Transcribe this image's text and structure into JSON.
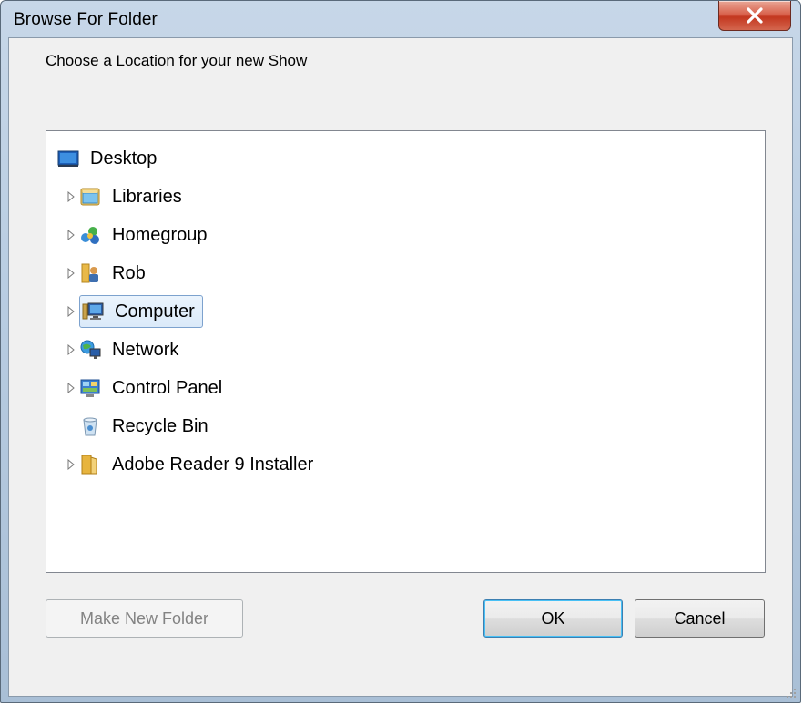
{
  "window": {
    "title": "Browse For Folder"
  },
  "dialog": {
    "prompt": "Choose a Location for your new Show"
  },
  "tree": {
    "items": [
      {
        "label": "Desktop",
        "icon": "desktop-icon",
        "expandable": false,
        "selected": false
      },
      {
        "label": "Libraries",
        "icon": "libraries-icon",
        "expandable": true,
        "selected": false
      },
      {
        "label": "Homegroup",
        "icon": "homegroup-icon",
        "expandable": true,
        "selected": false
      },
      {
        "label": "Rob",
        "icon": "user-folder-icon",
        "expandable": true,
        "selected": false
      },
      {
        "label": "Computer",
        "icon": "computer-icon",
        "expandable": true,
        "selected": true
      },
      {
        "label": "Network",
        "icon": "network-icon",
        "expandable": true,
        "selected": false
      },
      {
        "label": "Control Panel",
        "icon": "control-panel-icon",
        "expandable": true,
        "selected": false
      },
      {
        "label": "Recycle Bin",
        "icon": "recycle-bin-icon",
        "expandable": false,
        "selected": false
      },
      {
        "label": "Adobe Reader 9 Installer",
        "icon": "folder-icon",
        "expandable": true,
        "selected": false
      }
    ]
  },
  "buttons": {
    "make_new_folder": "Make New Folder",
    "ok": "OK",
    "cancel": "Cancel"
  },
  "colors": {
    "titlebar": "#b9cde2",
    "close_button": "#c3371f",
    "selection": "#dbeaf9",
    "dialog_bg": "#f0f0f0"
  }
}
